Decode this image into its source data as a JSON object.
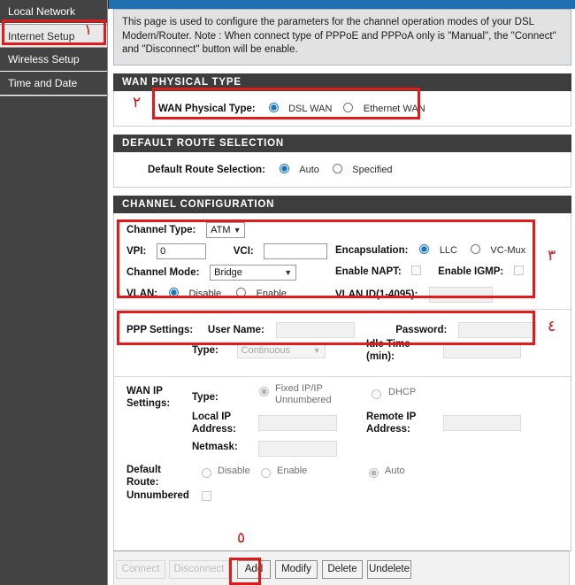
{
  "sidebar": {
    "items": [
      {
        "label": "Local Network",
        "selected": false
      },
      {
        "label": "Internet Setup",
        "selected": true
      },
      {
        "label": "Wireless Setup",
        "selected": false
      },
      {
        "label": "Time and Date",
        "selected": false
      }
    ]
  },
  "intro": {
    "text": "This page is used to configure the parameters for the channel operation modes of your DSL Modem/Router. Note : When connect type of PPPoE and PPPoA only is \"Manual\", the \"Connect\" and \"Disconnect\" button will be enable."
  },
  "wan_physical_type": {
    "heading": "WAN PHYSICAL TYPE",
    "label": "WAN Physical Type:",
    "options": [
      {
        "label": "DSL WAN",
        "selected": true
      },
      {
        "label": "Ethernet WAN",
        "selected": false
      }
    ]
  },
  "default_route_selection": {
    "heading": "DEFAULT ROUTE SELECTION",
    "label": "Default Route Selection:",
    "options": [
      {
        "label": "Auto",
        "selected": true
      },
      {
        "label": "Specified",
        "selected": false
      }
    ]
  },
  "channel_configuration": {
    "heading": "CHANNEL CONFIGURATION",
    "channel_type": {
      "label": "Channel Type:",
      "value": "ATM"
    },
    "vpi": {
      "label": "VPI:",
      "value": "0"
    },
    "vci": {
      "label": "VCI:",
      "value": ""
    },
    "channel_mode": {
      "label": "Channel Mode:",
      "value": "Bridge"
    },
    "vlan": {
      "label": "VLAN:",
      "options": [
        {
          "label": "Disable",
          "selected": true
        },
        {
          "label": "Enable",
          "selected": false
        }
      ]
    },
    "encapsulation": {
      "label": "Encapsulation:",
      "options": [
        {
          "label": "LLC",
          "selected": true
        },
        {
          "label": "VC-Mux",
          "selected": false
        }
      ]
    },
    "enable_napt": {
      "label": "Enable NAPT:",
      "checked": false
    },
    "enable_igmp": {
      "label": "Enable IGMP:",
      "checked": false
    },
    "vlan_id": {
      "label": "VLAN ID(1-4095):",
      "value": ""
    }
  },
  "ppp_settings": {
    "label": "PPP Settings:",
    "user_name": {
      "label": "User Name:",
      "value": ""
    },
    "password": {
      "label": "Password:",
      "value": ""
    },
    "type": {
      "label": "Type:",
      "value": "Continuous"
    },
    "idle_time": {
      "label": "Idle Time (min):",
      "value": ""
    }
  },
  "wan_ip_settings": {
    "label": "WAN IP Settings:",
    "type": {
      "label": "Type:",
      "options": [
        {
          "label": "Fixed IP/IP Unnumbered",
          "selected": true
        },
        {
          "label": "DHCP",
          "selected": false
        }
      ]
    },
    "local_ip_address": {
      "label": "Local IP Address:",
      "value": ""
    },
    "remote_ip_address": {
      "label": "Remote IP Address:",
      "value": ""
    },
    "netmask": {
      "label": "Netmask:",
      "value": ""
    },
    "default_route": {
      "label": "Default Route:",
      "options": [
        {
          "label": "Disable",
          "selected": false
        },
        {
          "label": "Enable",
          "selected": false
        },
        {
          "label": "Auto",
          "selected": true
        }
      ]
    },
    "unnumbered": {
      "label": "Unnumbered",
      "checked": false
    }
  },
  "footer": {
    "buttons": [
      {
        "label": "Connect",
        "enabled": false
      },
      {
        "label": "Disconnect",
        "enabled": false
      },
      {
        "label": "Add",
        "enabled": true
      },
      {
        "label": "Modify",
        "enabled": true
      },
      {
        "label": "Delete",
        "enabled": true
      },
      {
        "label": "Undelete",
        "enabled": true
      }
    ]
  },
  "annotations": {
    "step1": "١",
    "step2": "٢",
    "step3": "٣",
    "step4": "٤",
    "step5": "٥"
  },
  "colors": {
    "accent_blue": "#1f6eb0",
    "annotation_red": "#e01b1b",
    "sidebar_bg": "#434343",
    "section_header": "#3d3d3d",
    "radio_selected": "#1a73c8"
  }
}
